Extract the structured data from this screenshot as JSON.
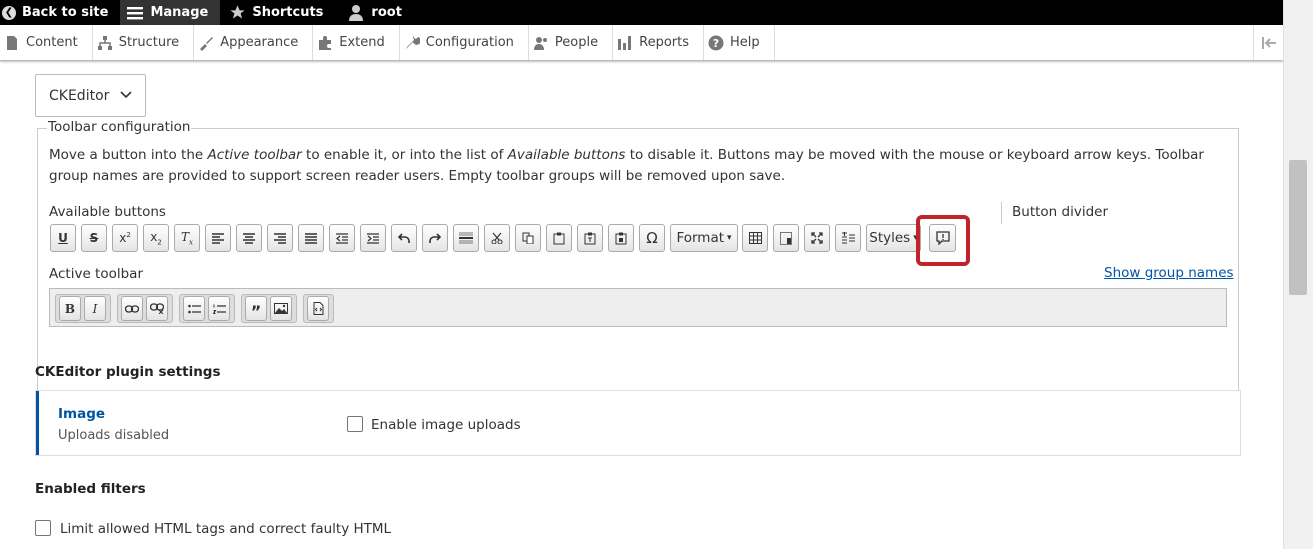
{
  "admin_bar": {
    "back_label": "Back to site",
    "manage_label": "Manage",
    "shortcuts_label": "Shortcuts",
    "user_label": "root"
  },
  "tray": {
    "tabs": [
      "Content",
      "Structure",
      "Appearance",
      "Extend",
      "Configuration",
      "People",
      "Reports",
      "Help"
    ]
  },
  "editor_select": {
    "value": "CKEditor"
  },
  "toolbar_config": {
    "legend": "Toolbar configuration",
    "desc_1": "Move a button into the ",
    "desc_em1": "Active toolbar",
    "desc_2": " to enable it, or into the list of ",
    "desc_em2": "Available buttons",
    "desc_3": " to disable it. Buttons may be moved with the mouse or keyboard arrow keys. Toolbar group names are provided to support screen reader users. Empty toolbar groups will be removed upon save.",
    "available_label": "Available buttons",
    "divider_label": "Button divider",
    "format_label": "Format",
    "styles_label": "Styles",
    "active_label": "Active toolbar",
    "show_group_names": "Show group names"
  },
  "plugin_settings": {
    "title": "CKEditor plugin settings",
    "tab_title": "Image",
    "tab_summary": "Uploads disabled",
    "enable_uploads_label": "Enable image uploads"
  },
  "filters": {
    "title": "Enabled filters",
    "limit_html_label": "Limit allowed HTML tags and correct faulty HTML"
  },
  "colors": {
    "accent": "#0054a6",
    "highlight": "#c0242a"
  }
}
